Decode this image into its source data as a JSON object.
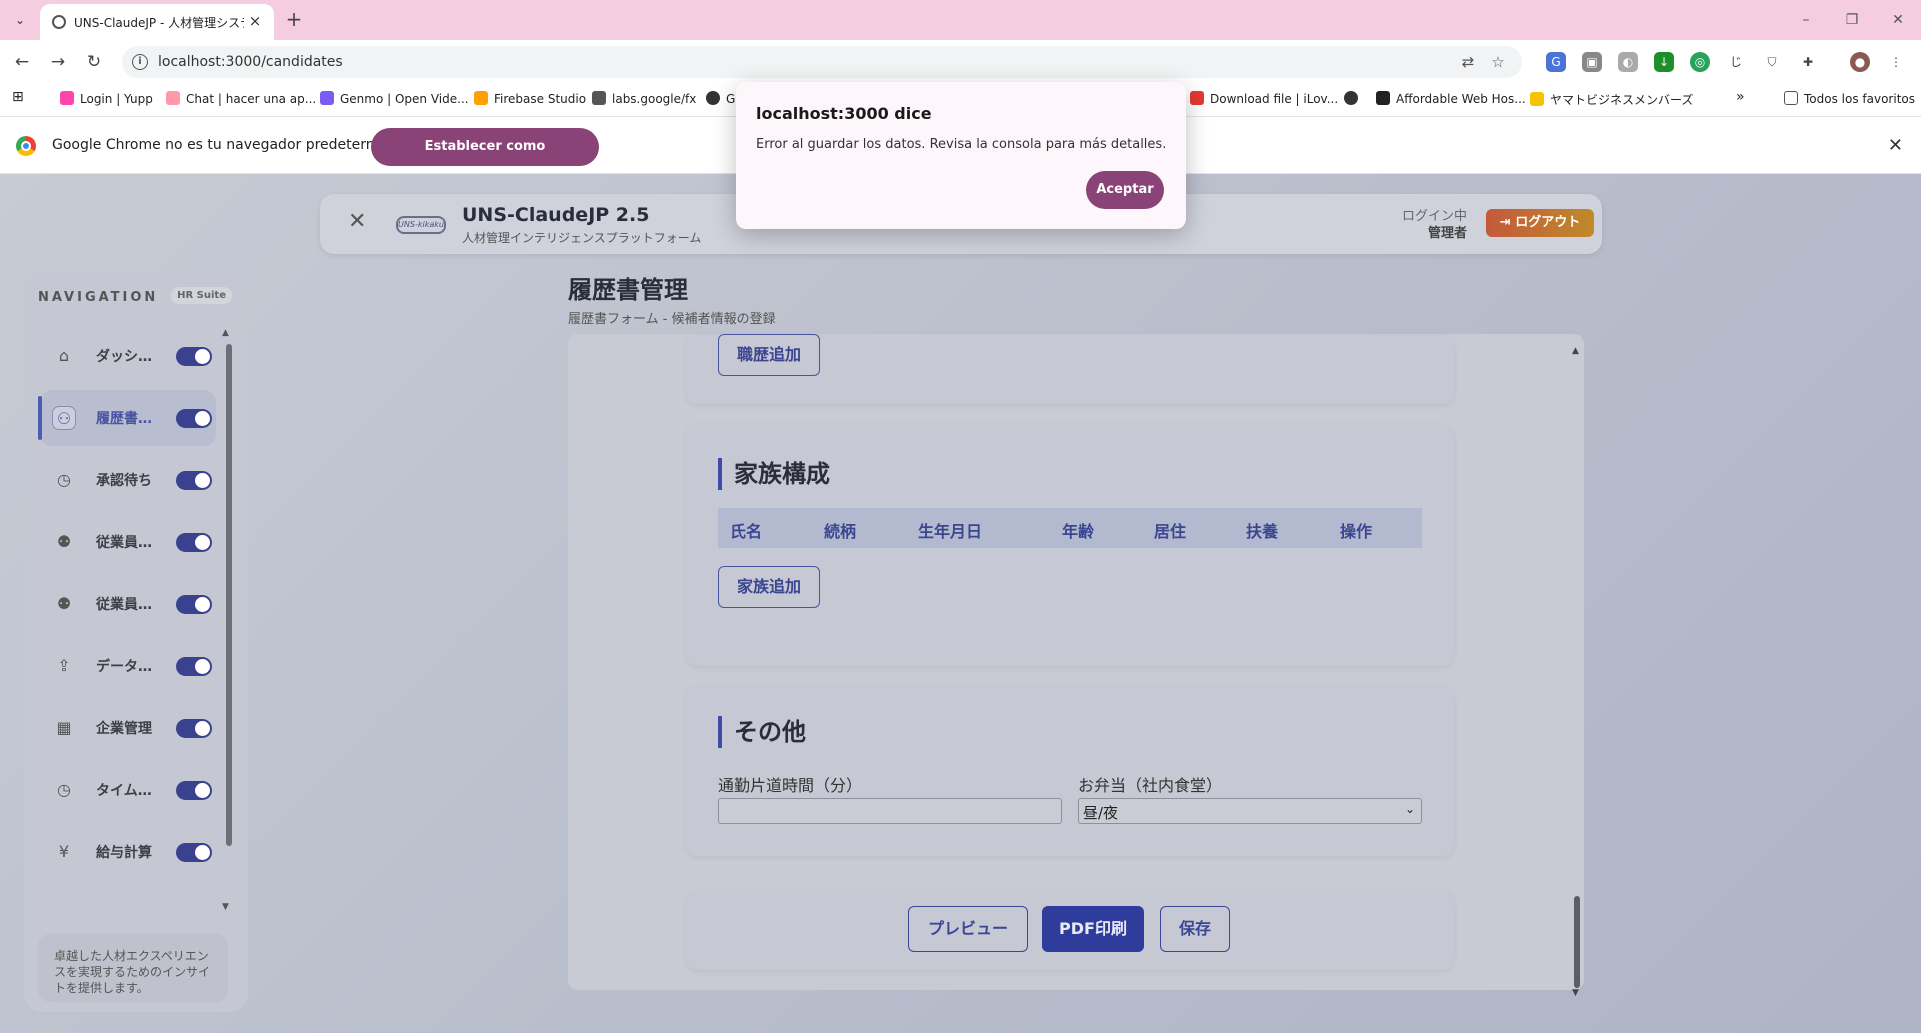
{
  "browser": {
    "tab_title": "UNS-ClaudeJP - 人材管理システ…",
    "url": "localhost:3000/candidates",
    "bookmarks": [
      "Login | Yupp",
      "Chat | hacer una ap...",
      "Genmo | Open Vide...",
      "Firebase Studio",
      "labs.google/fx",
      "G",
      "Download file | iLov...",
      "Affordable Web Hos...",
      "ヤマトビジネスメンバーズ"
    ],
    "bookmarks_overflow": "»",
    "all_bookmarks": "Todos los favoritos",
    "infobar": {
      "text": "Google Chrome no es tu navegador predeterminado",
      "button": "Establecer como predeterminado"
    }
  },
  "dialog": {
    "title": "localhost:3000 dice",
    "message": "Error al guardar los datos. Revisa la consola para más detalles.",
    "button": "Aceptar"
  },
  "header": {
    "logo_text": "UNS-kikaku",
    "title": "UNS-ClaudeJP 2.5",
    "subtitle": "人材管理インテリジェンスプラットフォーム",
    "login_label": "ログイン中",
    "user": "管理者",
    "logout": "ログアウト"
  },
  "sidebar": {
    "heading": "NAVIGATION",
    "badge": "HR Suite",
    "items": [
      {
        "label": "ダッシ…",
        "icon": "home-icon",
        "glyph": "⌂"
      },
      {
        "label": "履歴書…",
        "icon": "user-add-icon",
        "glyph": "⚇"
      },
      {
        "label": "承認待ち",
        "icon": "clock-icon",
        "glyph": "◷"
      },
      {
        "label": "従業員…",
        "icon": "users-icon",
        "glyph": "⚉"
      },
      {
        "label": "従業員…",
        "icon": "users-icon",
        "glyph": "⚉"
      },
      {
        "label": "データ…",
        "icon": "upload-icon",
        "glyph": "⇪"
      },
      {
        "label": "企業管理",
        "icon": "building-icon",
        "glyph": "▦"
      },
      {
        "label": "タイム…",
        "icon": "clock-icon",
        "glyph": "◷"
      },
      {
        "label": "給与計算",
        "icon": "yen-icon",
        "glyph": "¥"
      }
    ],
    "active_index": 1,
    "footer": "卓越した人材エクスペリエンスを実現するためのインサイトを提供します。"
  },
  "page": {
    "title": "履歴書管理",
    "subtitle": "履歴書フォーム - 候補者情報の登録"
  },
  "work_history": {
    "add_button": "職歴追加"
  },
  "family": {
    "title": "家族構成",
    "columns": [
      "氏名",
      "続柄",
      "生年月日",
      "年齢",
      "居住",
      "扶養",
      "操作"
    ],
    "add_button": "家族追加"
  },
  "other": {
    "title": "その他",
    "commute_label": "通勤片道時間（分）",
    "commute_value": "",
    "lunch_label": "お弁当（社内食堂）",
    "lunch_value": "昼/夜"
  },
  "actions": {
    "preview": "プレビュー",
    "pdf": "PDF印刷",
    "save": "保存"
  }
}
